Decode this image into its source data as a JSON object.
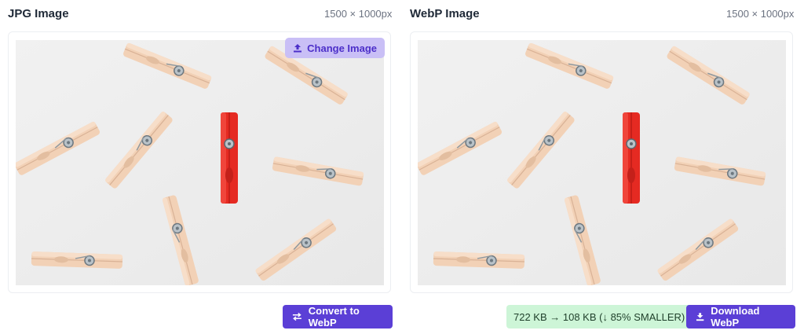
{
  "left_panel": {
    "title": "JPG Image",
    "dimensions": "1500 × 1000px",
    "change_button_label": "Change Image",
    "convert_button_label": "Convert to WebP"
  },
  "right_panel": {
    "title": "WebP Image",
    "dimensions": "1500 × 1000px",
    "size_badge": "722 KB → 108 KB (↓ 85% SMALLER)",
    "download_button_label": "Download WebP"
  },
  "colors": {
    "accent": "#5b3fd6",
    "accent_light": "#c9bff6",
    "success_bg": "#cdf5d7",
    "clothespin_wood": "#f0cdb2",
    "clothespin_red": "#e52a22"
  },
  "icons": {
    "change": "upload-icon",
    "convert": "swap-arrows-icon",
    "download": "download-icon"
  }
}
